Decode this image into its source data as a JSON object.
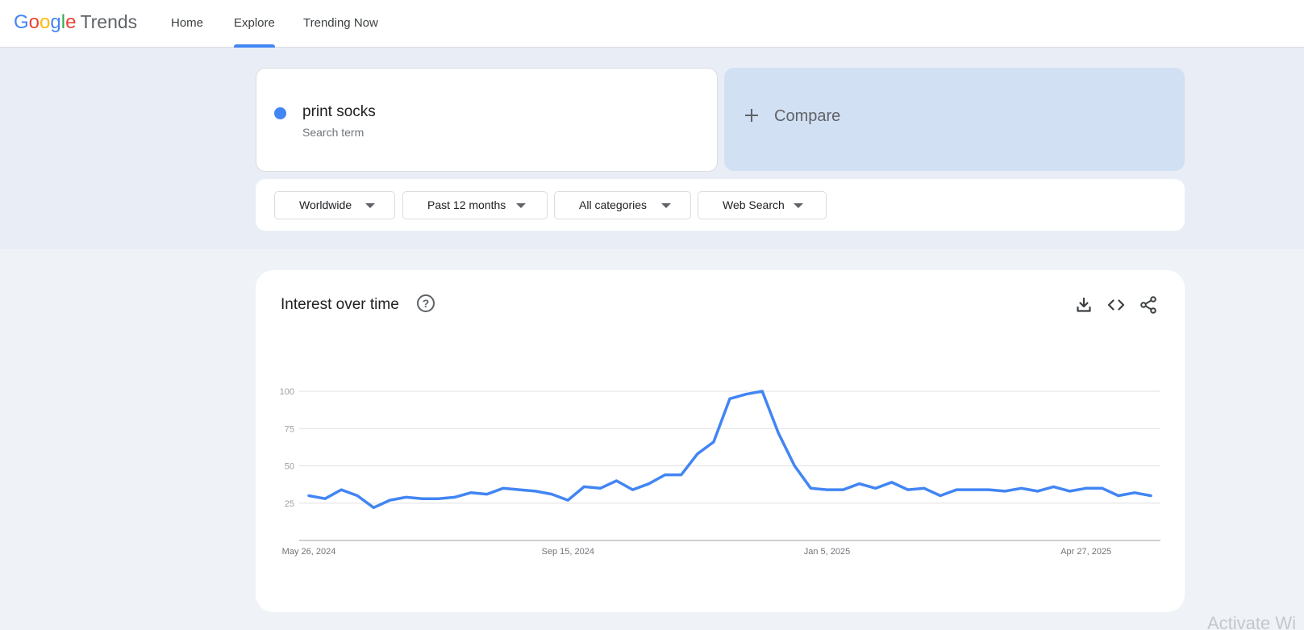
{
  "header": {
    "logo_word": "Trends",
    "logo_letters": [
      {
        "ch": "G",
        "color": "#4285f4"
      },
      {
        "ch": "o",
        "color": "#ea4335"
      },
      {
        "ch": "o",
        "color": "#fbbc05"
      },
      {
        "ch": "g",
        "color": "#4285f4"
      },
      {
        "ch": "l",
        "color": "#34a853"
      },
      {
        "ch": "e",
        "color": "#ea4335"
      }
    ],
    "nav": {
      "home": "Home",
      "explore": "Explore",
      "trending": "Trending Now"
    },
    "active_tab": "Explore"
  },
  "search": {
    "term": "print socks",
    "term_type": "Search term",
    "term_color": "#4285f4",
    "compare_label": "Compare"
  },
  "filters": {
    "region": "Worldwide",
    "period": "Past 12 months",
    "category": "All categories",
    "property": "Web Search"
  },
  "chart_panel": {
    "title": "Interest over time",
    "help_icon": "help-circle-icon",
    "actions": [
      "download-icon",
      "embed-code-icon",
      "share-icon"
    ]
  },
  "chart_data": {
    "type": "line",
    "title": "",
    "xlabel": "",
    "ylabel": "",
    "ylim": [
      0,
      100
    ],
    "y_ticks": [
      25,
      50,
      75,
      100
    ],
    "x_tick_labels": [
      "May 26, 2024",
      "Sep 15, 2024",
      "Jan 5, 2025",
      "Apr 27, 2025"
    ],
    "grid": true,
    "series": [
      {
        "color": "#4285f4",
        "values": [
          30,
          28,
          34,
          30,
          22,
          27,
          29,
          28,
          28,
          29,
          32,
          31,
          35,
          34,
          33,
          31,
          27,
          36,
          35,
          40,
          34,
          38,
          44,
          44,
          58,
          66,
          95,
          98,
          100,
          72,
          50,
          35,
          34,
          34,
          38,
          35,
          39,
          34,
          35,
          30,
          34,
          34,
          34,
          33,
          35,
          33,
          36,
          33,
          35,
          35,
          30,
          32,
          30
        ]
      }
    ]
  },
  "watermark": "Activate Wi"
}
